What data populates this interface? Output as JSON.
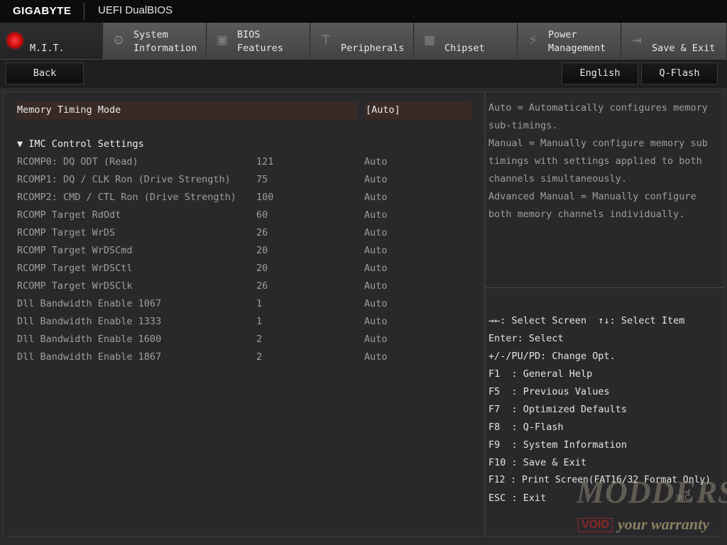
{
  "header": {
    "brand": "GIGABYTE",
    "title": "UEFI DualBIOS"
  },
  "tabs": [
    {
      "name": "M.I.T.",
      "line1": "M.I.T.",
      "line2": "",
      "icon": "mit-icon",
      "active": true
    },
    {
      "name": "System Information",
      "line1": "System",
      "line2": "Information",
      "icon": "gear-icon",
      "active": false
    },
    {
      "name": "BIOS Features",
      "line1": "BIOS",
      "line2": "Features",
      "icon": "bios-icon",
      "active": false
    },
    {
      "name": "Peripherals",
      "line1": "Peripherals",
      "line2": "",
      "icon": "plug-icon",
      "active": false
    },
    {
      "name": "Chipset",
      "line1": "Chipset",
      "line2": "",
      "icon": "chip-icon",
      "active": false
    },
    {
      "name": "Power Management",
      "line1": "Power",
      "line2": "Management",
      "icon": "power-icon",
      "active": false
    },
    {
      "name": "Save & Exit",
      "line1": "Save & Exit",
      "line2": "",
      "icon": "exit-icon",
      "active": false
    }
  ],
  "subbar": {
    "back": "Back",
    "language": "English",
    "qflash": "Q-Flash"
  },
  "settings": {
    "memory_timing_mode": {
      "label": "Memory Timing Mode",
      "value": "[Auto]"
    },
    "section_title": "▼ IMC Control Settings",
    "rows": [
      {
        "label": "RCOMP0: DQ ODT (Read)",
        "num": "121",
        "value": "Auto"
      },
      {
        "label": "RCOMP1: DQ / CLK Ron (Drive Strength)",
        "num": "75",
        "value": "Auto"
      },
      {
        "label": "RCOMP2: CMD / CTL Ron (Drive Strength)",
        "num": "100",
        "value": "Auto"
      },
      {
        "label": "RCOMP Target RdOdt",
        "num": "60",
        "value": "Auto"
      },
      {
        "label": "RCOMP Target WrDS",
        "num": "26",
        "value": "Auto"
      },
      {
        "label": "RCOMP Target WrDSCmd",
        "num": "20",
        "value": "Auto"
      },
      {
        "label": "RCOMP Target WrDSCtl",
        "num": "20",
        "value": "Auto"
      },
      {
        "label": "RCOMP Target WrDSClk",
        "num": "26",
        "value": "Auto"
      },
      {
        "label": "Dll Bandwidth Enable 1067",
        "num": "1",
        "value": "Auto"
      },
      {
        "label": "Dll Bandwidth Enable 1333",
        "num": "1",
        "value": "Auto"
      },
      {
        "label": "Dll Bandwidth Enable 1600",
        "num": "2",
        "value": "Auto"
      },
      {
        "label": "Dll Bandwidth Enable 1867",
        "num": "2",
        "value": "Auto"
      }
    ]
  },
  "help": {
    "lines": [
      "Auto = Automatically configures memory",
      "sub-timings.",
      "Manual = Manually configure memory sub",
      "timings with settings applied to both",
      "channels simultaneously.",
      "Advanced Manual = Manually configure",
      "both memory channels individually."
    ]
  },
  "keys": {
    "lines": [
      "→←: Select Screen  ↑↓: Select Item",
      "Enter: Select",
      "+/-/PU/PD: Change Opt.",
      "F1  : General Help",
      "F5  : Previous Values",
      "F7  : Optimized Defaults",
      "F8  : Q-Flash",
      "F9  : System Information",
      "F10 : Save & Exit",
      "F12 : Print Screen(FAT16/32 Format Only)",
      "ESC : Exit"
    ]
  },
  "watermark": {
    "main": "MODDERS",
    "inc": "INC.",
    "void": "VOID",
    "warranty": "your warranty"
  },
  "colors": {
    "accent_red": "#cc0000",
    "selected_row_bg": "#3a2a25",
    "panel_bg": "#29292b"
  }
}
